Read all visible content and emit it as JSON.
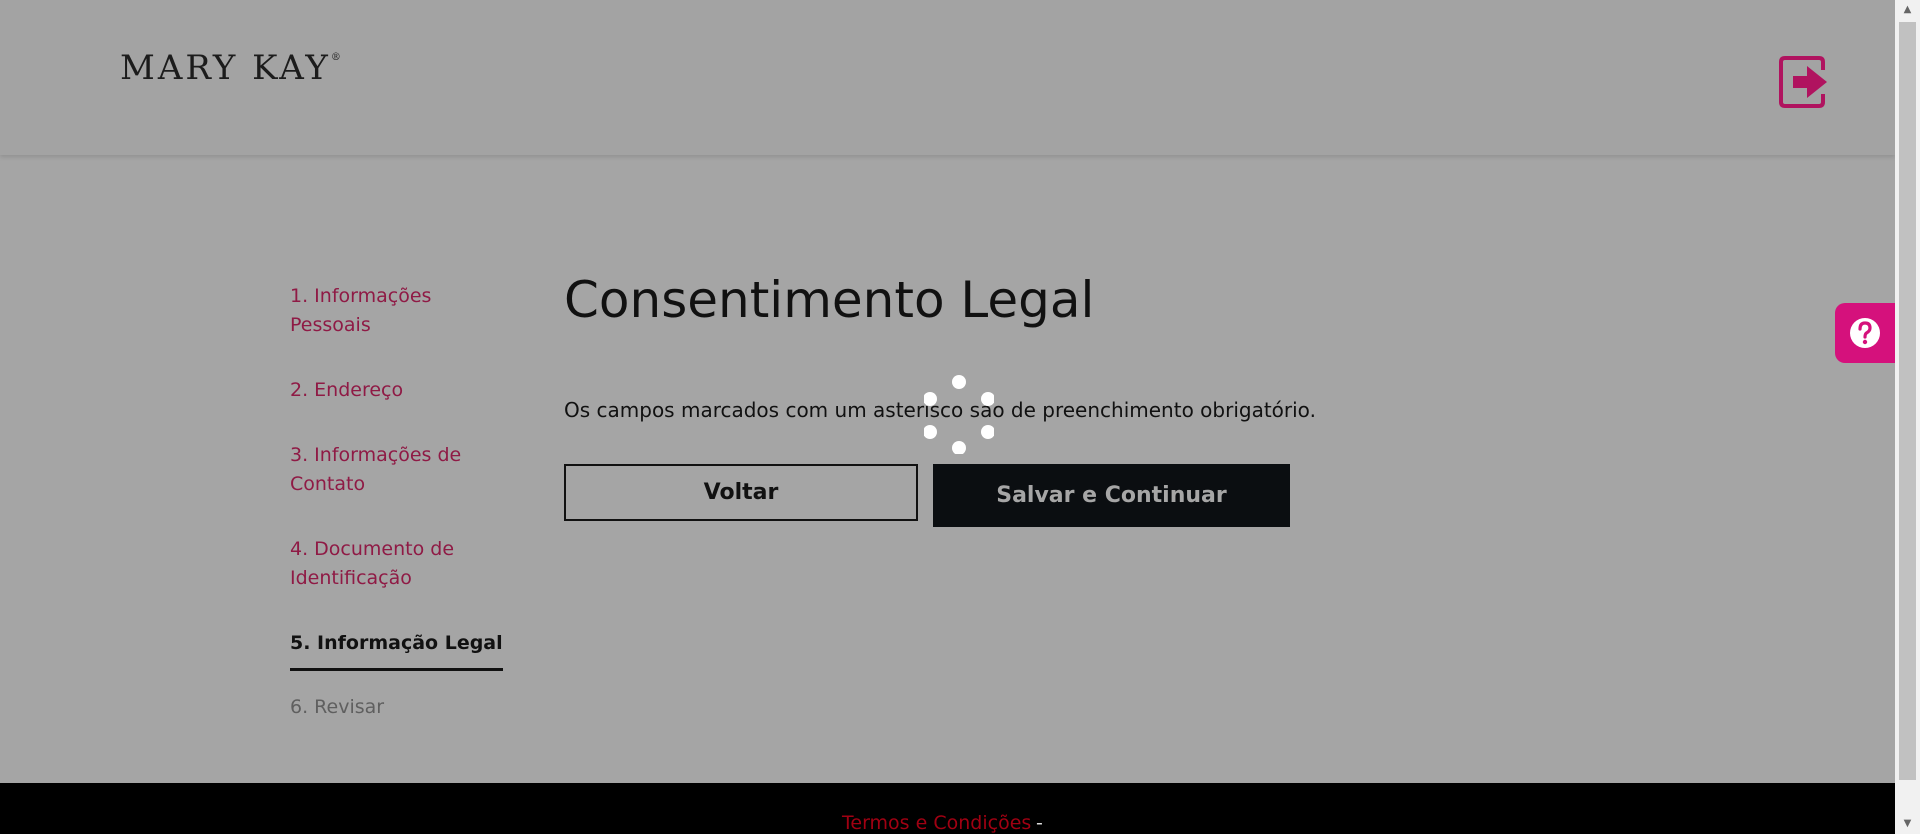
{
  "header": {
    "logo": "MARY KAY",
    "logo_mark": "®",
    "logout_icon": "logout-icon",
    "accent_color": "#b0135f"
  },
  "sidebar": {
    "steps": [
      {
        "label": "1. Informações Pessoais",
        "state": "completed"
      },
      {
        "label": "2. Endereço",
        "state": "completed"
      },
      {
        "label": "3. Informações de Contato",
        "state": "completed"
      },
      {
        "label": "4. Documento de Identificação",
        "state": "completed"
      },
      {
        "label": "5. Informação Legal",
        "state": "active"
      },
      {
        "label": "6. Revisar",
        "state": "disabled"
      }
    ]
  },
  "main": {
    "title": "Consentimento Legal",
    "required_note": "Os campos marcados com um asterisco são de preenchimento obrigatório.",
    "back_label": "Voltar",
    "save_label": "Salvar e Continuar",
    "loading_icon": "loading-spinner-icon"
  },
  "help": {
    "icon": "help-icon",
    "color": "#d5117c"
  },
  "footer": {
    "terms_link": "Termos e Condições",
    "separator": "-",
    "link_color": "#a00012"
  },
  "scrollbar": {
    "up_icon": "▲",
    "down_icon": "▼"
  }
}
